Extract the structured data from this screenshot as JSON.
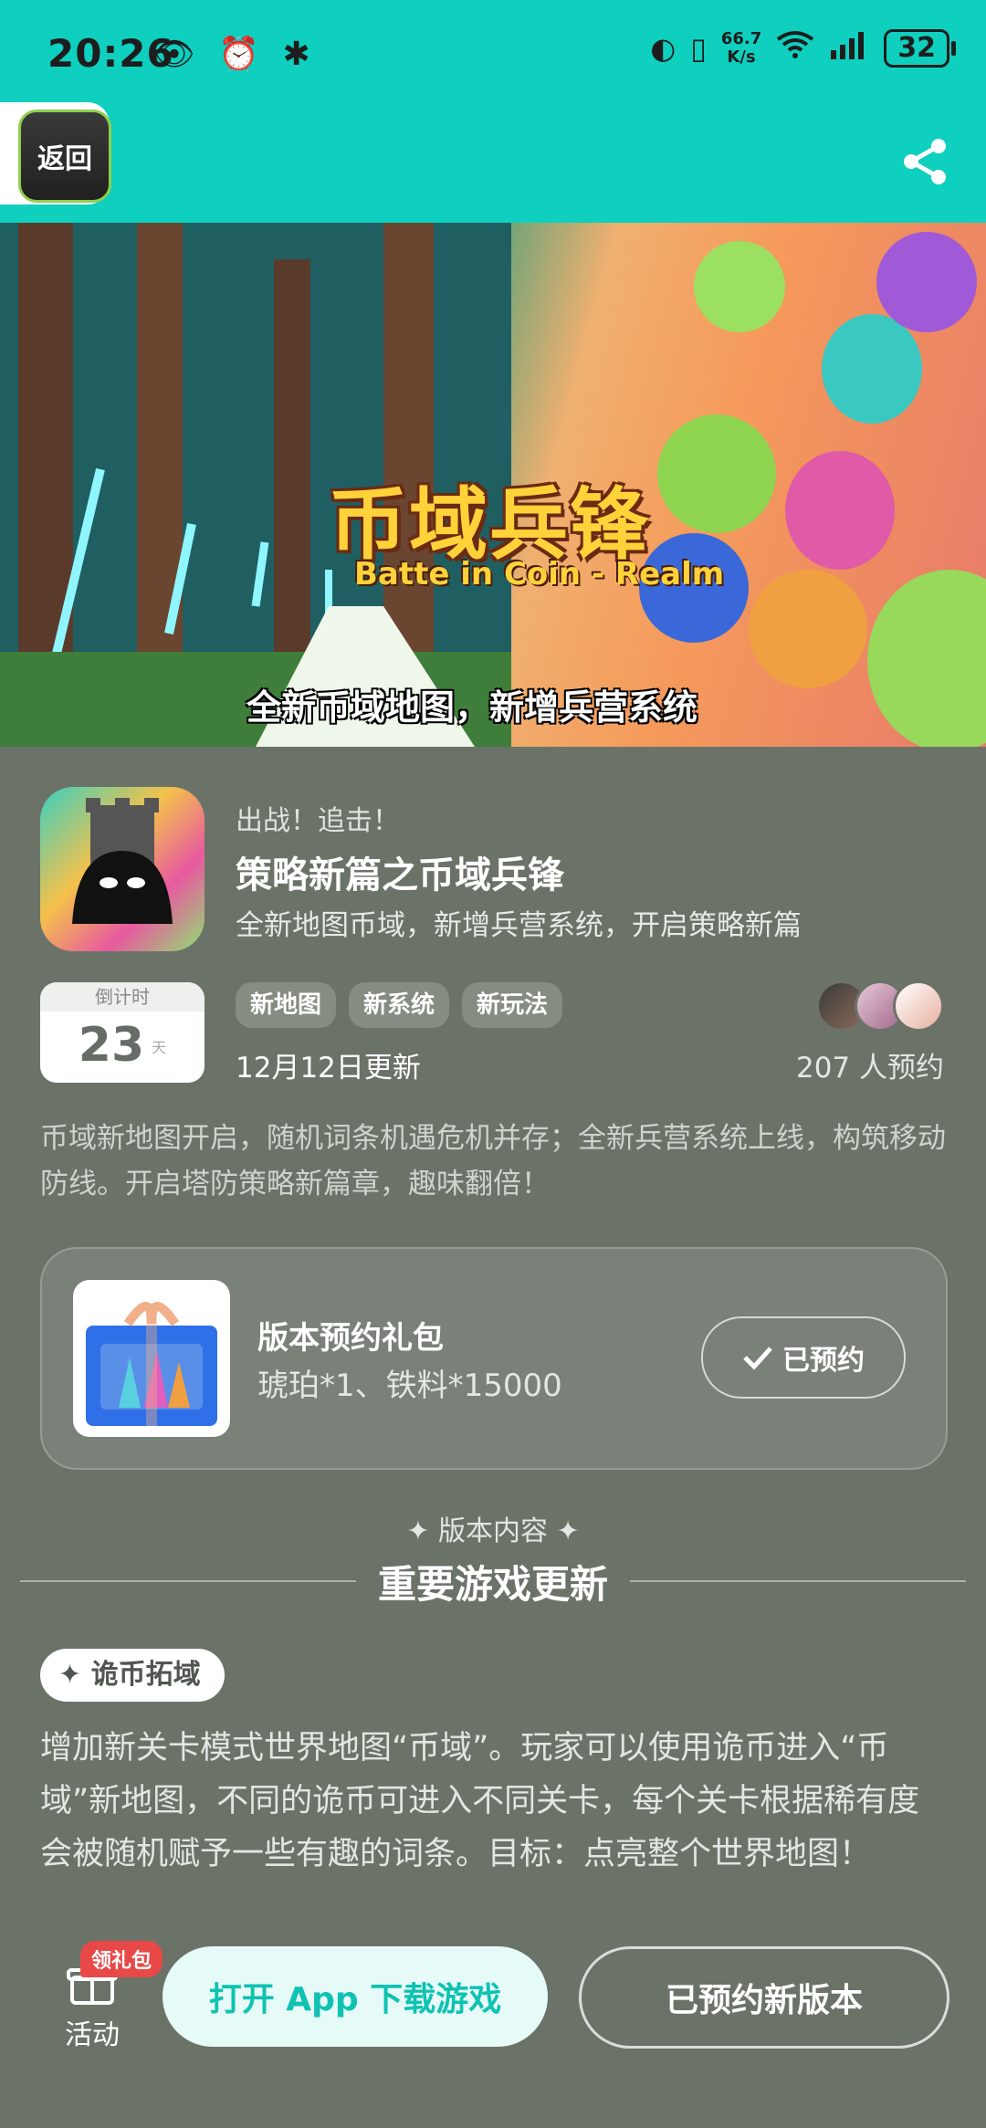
{
  "status_bar": {
    "time": "20:26",
    "netspeed_value": "66.7",
    "netspeed_unit": "K/s",
    "battery": "32"
  },
  "header": {
    "back_label": "返回"
  },
  "banner": {
    "title": "币域兵锋",
    "subtitle": "Batte in Coin - Realm",
    "caption": "全新币域地图，新增兵营系统"
  },
  "app": {
    "tagline": "出战！追击！",
    "title": "策略新篇之币域兵锋",
    "description": "全新地图币域，新增兵营系统，开启策略新篇"
  },
  "countdown": {
    "label": "倒计时",
    "value": "23",
    "unit": "天"
  },
  "tags": [
    "新地图",
    "新系统",
    "新玩法"
  ],
  "update_date": "12月12日更新",
  "reservations": "207 人预约",
  "long_description": "币域新地图开启，随机词条机遇危机并存；全新兵营系统上线，构筑移动防线。开启塔防策略新篇章，趣味翻倍！",
  "gift": {
    "title": "版本预约礼包",
    "items": "琥珀*1、铁料*15000",
    "button": "已预约"
  },
  "section": {
    "eyebrow": "版本内容",
    "heading": "重要游戏更新"
  },
  "feature": {
    "chip": "诡币拓域",
    "text": "增加新关卡模式世界地图“币域”。玩家可以使用诡币进入“币域”新地图，不同的诡币可进入不同关卡，每个关卡根据稀有度会被随机赋予一些有趣的词条。目标：点亮整个世界地图！"
  },
  "bottom_bar": {
    "activity_label": "活动",
    "gift_badge": "领礼包",
    "open_app": "打开 App 下载游戏",
    "reserved_version": "已预约新版本"
  },
  "colors": {
    "accent": "#0fcfbf",
    "background": "#6b7369",
    "badge": "#e84848"
  }
}
